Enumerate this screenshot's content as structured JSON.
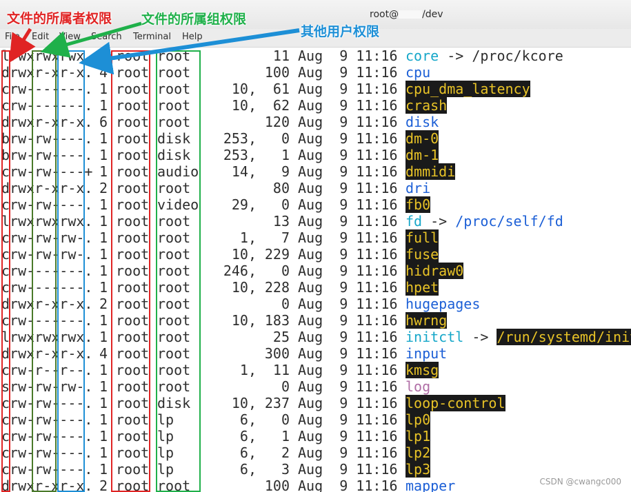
{
  "window": {
    "title_prefix": "root@",
    "title_suffix": "/dev"
  },
  "menubar": {
    "items": [
      "File",
      "Edit",
      "View",
      "Search",
      "Terminal",
      "Help"
    ]
  },
  "annotations": {
    "owner": {
      "label": "文件的所属者权限",
      "color": "#e02424"
    },
    "group": {
      "label": "文件的所属组权限",
      "color": "#1fb04a"
    },
    "others": {
      "label": "其他用户权限",
      "color": "#1d8fd6"
    }
  },
  "colors": {
    "directory": "#1c5fd6",
    "symlink": "#16a7c9",
    "device_fg": "#e8c327",
    "device_bg": "#1a1a1a",
    "socket": "#b06ea6"
  },
  "listing": [
    {
      "perm": "lrwxrwxrwx.",
      "links": "1",
      "owner": "root",
      "group": "root",
      "maj": "",
      "size": "11",
      "date": "Aug  9 11:16",
      "name": "core",
      "type": "link",
      "target": "/proc/kcore",
      "target_type": "plain"
    },
    {
      "perm": "drwxr-xr-x.",
      "links": "4",
      "owner": "root",
      "group": "root",
      "maj": "",
      "size": "100",
      "date": "Aug  9 11:16",
      "name": "cpu",
      "type": "dir"
    },
    {
      "perm": "crw-------.",
      "links": "1",
      "owner": "root",
      "group": "root",
      "maj": "10,",
      "size": "61",
      "date": "Aug  9 11:16",
      "name": "cpu_dma_latency",
      "type": "dev"
    },
    {
      "perm": "crw-------.",
      "links": "1",
      "owner": "root",
      "group": "root",
      "maj": "10,",
      "size": "62",
      "date": "Aug  9 11:16",
      "name": "crash",
      "type": "dev"
    },
    {
      "perm": "drwxr-xr-x.",
      "links": "6",
      "owner": "root",
      "group": "root",
      "maj": "",
      "size": "120",
      "date": "Aug  9 11:16",
      "name": "disk",
      "type": "dir"
    },
    {
      "perm": "brw-rw----.",
      "links": "1",
      "owner": "root",
      "group": "disk",
      "maj": "253,",
      "size": "0",
      "date": "Aug  9 11:16",
      "name": "dm-0",
      "type": "dev"
    },
    {
      "perm": "brw-rw----.",
      "links": "1",
      "owner": "root",
      "group": "disk",
      "maj": "253,",
      "size": "1",
      "date": "Aug  9 11:16",
      "name": "dm-1",
      "type": "dev"
    },
    {
      "perm": "crw-rw----+",
      "links": "1",
      "owner": "root",
      "group": "audio",
      "maj": "14,",
      "size": "9",
      "date": "Aug  9 11:16",
      "name": "dmmidi",
      "type": "dev"
    },
    {
      "perm": "drwxr-xr-x.",
      "links": "2",
      "owner": "root",
      "group": "root",
      "maj": "",
      "size": "80",
      "date": "Aug  9 11:16",
      "name": "dri",
      "type": "dir"
    },
    {
      "perm": "crw-rw----.",
      "links": "1",
      "owner": "root",
      "group": "video",
      "maj": "29,",
      "size": "0",
      "date": "Aug  9 11:16",
      "name": "fb0",
      "type": "dev"
    },
    {
      "perm": "lrwxrwxrwx.",
      "links": "1",
      "owner": "root",
      "group": "root",
      "maj": "",
      "size": "13",
      "date": "Aug  9 11:16",
      "name": "fd",
      "type": "link",
      "target": "/proc/self/fd",
      "target_type": "dir"
    },
    {
      "perm": "crw-rw-rw-.",
      "links": "1",
      "owner": "root",
      "group": "root",
      "maj": "1,",
      "size": "7",
      "date": "Aug  9 11:16",
      "name": "full",
      "type": "dev"
    },
    {
      "perm": "crw-rw-rw-.",
      "links": "1",
      "owner": "root",
      "group": "root",
      "maj": "10,",
      "size": "229",
      "date": "Aug  9 11:16",
      "name": "fuse",
      "type": "dev"
    },
    {
      "perm": "crw-------.",
      "links": "1",
      "owner": "root",
      "group": "root",
      "maj": "246,",
      "size": "0",
      "date": "Aug  9 11:16",
      "name": "hidraw0",
      "type": "dev"
    },
    {
      "perm": "crw-------.",
      "links": "1",
      "owner": "root",
      "group": "root",
      "maj": "10,",
      "size": "228",
      "date": "Aug  9 11:16",
      "name": "hpet",
      "type": "dev"
    },
    {
      "perm": "drwxr-xr-x.",
      "links": "2",
      "owner": "root",
      "group": "root",
      "maj": "",
      "size": "0",
      "date": "Aug  9 11:16",
      "name": "hugepages",
      "type": "dir"
    },
    {
      "perm": "crw-------.",
      "links": "1",
      "owner": "root",
      "group": "root",
      "maj": "10,",
      "size": "183",
      "date": "Aug  9 11:16",
      "name": "hwrng",
      "type": "dev"
    },
    {
      "perm": "lrwxrwxrwx.",
      "links": "1",
      "owner": "root",
      "group": "root",
      "maj": "",
      "size": "25",
      "date": "Aug  9 11:16",
      "name": "initctl",
      "type": "link",
      "target": "/run/systemd/initctl/fifo",
      "target_type": "dev"
    },
    {
      "perm": "drwxr-xr-x.",
      "links": "4",
      "owner": "root",
      "group": "root",
      "maj": "",
      "size": "300",
      "date": "Aug  9 11:16",
      "name": "input",
      "type": "dir"
    },
    {
      "perm": "crw-r--r--.",
      "links": "1",
      "owner": "root",
      "group": "root",
      "maj": "1,",
      "size": "11",
      "date": "Aug  9 11:16",
      "name": "kmsg",
      "type": "dev"
    },
    {
      "perm": "srw-rw-rw-.",
      "links": "1",
      "owner": "root",
      "group": "root",
      "maj": "",
      "size": "0",
      "date": "Aug  9 11:16",
      "name": "log",
      "type": "sock"
    },
    {
      "perm": "crw-rw----.",
      "links": "1",
      "owner": "root",
      "group": "disk",
      "maj": "10,",
      "size": "237",
      "date": "Aug  9 11:16",
      "name": "loop-control",
      "type": "dev"
    },
    {
      "perm": "crw-rw----.",
      "links": "1",
      "owner": "root",
      "group": "lp",
      "maj": "6,",
      "size": "0",
      "date": "Aug  9 11:16",
      "name": "lp0",
      "type": "dev"
    },
    {
      "perm": "crw-rw----.",
      "links": "1",
      "owner": "root",
      "group": "lp",
      "maj": "6,",
      "size": "1",
      "date": "Aug  9 11:16",
      "name": "lp1",
      "type": "dev"
    },
    {
      "perm": "crw-rw----.",
      "links": "1",
      "owner": "root",
      "group": "lp",
      "maj": "6,",
      "size": "2",
      "date": "Aug  9 11:16",
      "name": "lp2",
      "type": "dev"
    },
    {
      "perm": "crw-rw----.",
      "links": "1",
      "owner": "root",
      "group": "lp",
      "maj": "6,",
      "size": "3",
      "date": "Aug  9 11:16",
      "name": "lp3",
      "type": "dev"
    },
    {
      "perm": "drwxr-xr-x.",
      "links": "2",
      "owner": "root",
      "group": "root",
      "maj": "",
      "size": "100",
      "date": "Aug  9 11:16",
      "name": "mapper",
      "type": "dir"
    }
  ],
  "watermark": "CSDN @cwangc000"
}
